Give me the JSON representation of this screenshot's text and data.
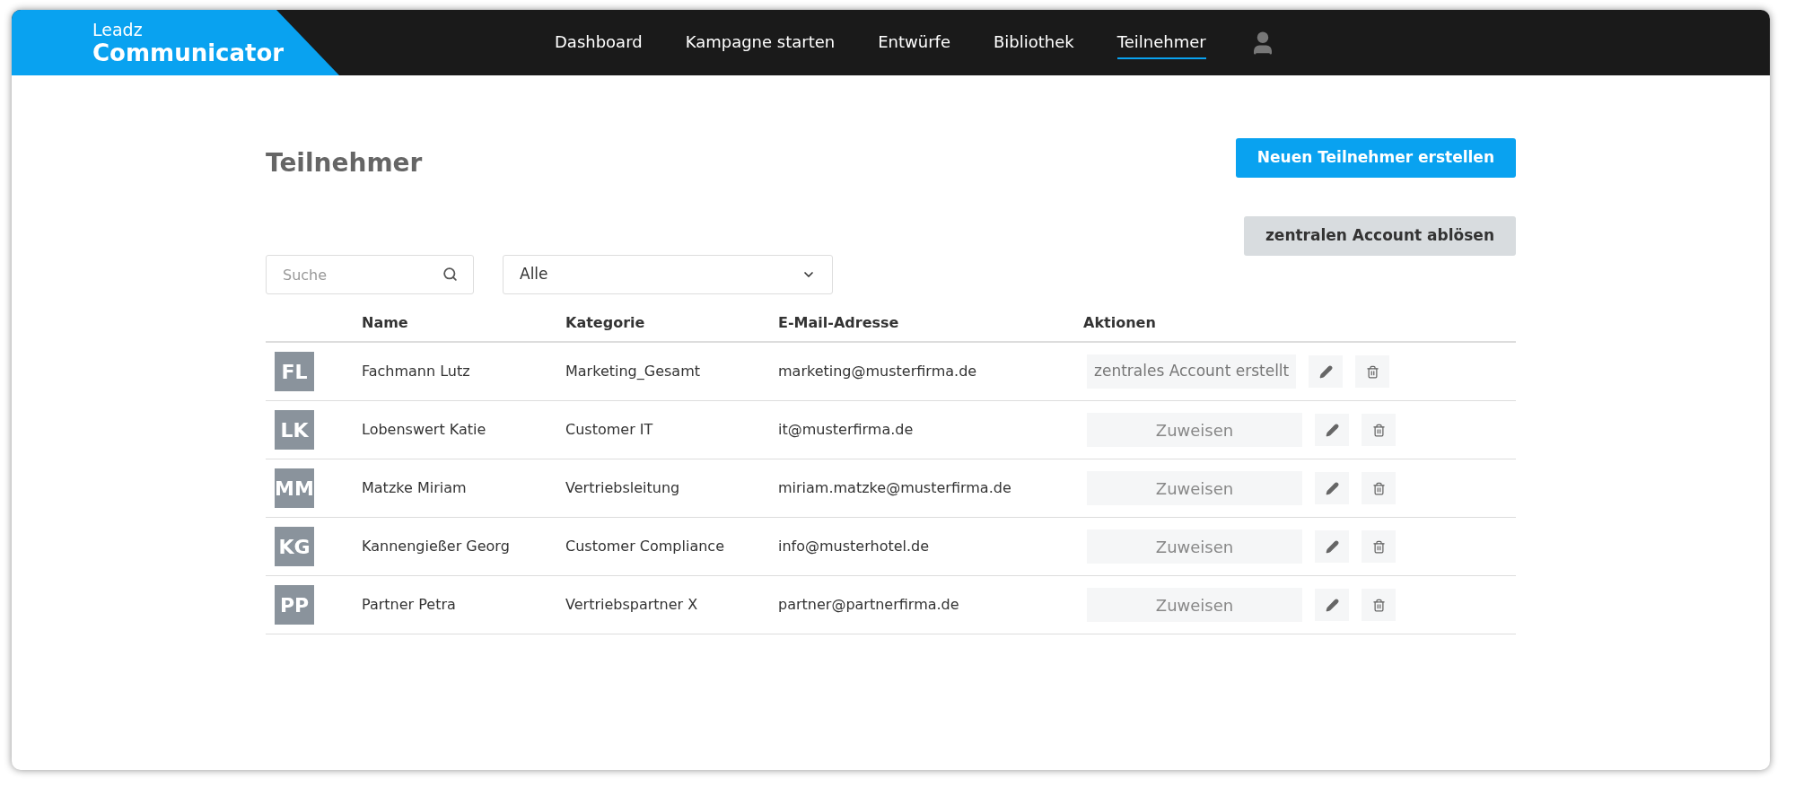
{
  "brand": {
    "top": "Leadz",
    "name": "Communicator"
  },
  "nav": [
    {
      "label": "Dashboard",
      "selected": false
    },
    {
      "label": "Kampagne starten",
      "selected": false
    },
    {
      "label": "Entwürfe",
      "selected": false
    },
    {
      "label": "Bibliothek",
      "selected": false
    },
    {
      "label": "Teilnehmer",
      "selected": true
    }
  ],
  "page_title": "Teilnehmer",
  "buttons": {
    "create": "Neuen Teilnehmer erstellen",
    "replace": "zentralen Account ablösen"
  },
  "search": {
    "placeholder": "Suche"
  },
  "filter": {
    "value": "Alle"
  },
  "table": {
    "columns": [
      "Name",
      "Kategorie",
      "E-Mail-Adresse",
      "Aktionen"
    ],
    "rows": [
      {
        "initials": "FL",
        "name": "Fachmann Lutz",
        "category": "Marketing_Gesamt",
        "email": "marketing@musterfirma.de",
        "action": {
          "kind": "status",
          "label": "zentrales Account erstellt"
        }
      },
      {
        "initials": "LK",
        "name": "Lobenswert Katie",
        "category": "Customer IT",
        "email": "it@musterfirma.de",
        "action": {
          "kind": "assign",
          "label": "Zuweisen"
        }
      },
      {
        "initials": "MM",
        "name": "Matzke Miriam",
        "category": "Vertriebsleitung",
        "email": "miriam.matzke@musterfirma.de",
        "action": {
          "kind": "assign",
          "label": "Zuweisen"
        }
      },
      {
        "initials": "KG",
        "name": "Kannengießer Georg",
        "category": "Customer Compliance",
        "email": "info@musterhotel.de",
        "action": {
          "kind": "assign",
          "label": "Zuweisen"
        }
      },
      {
        "initials": "PP",
        "name": "Partner Petra",
        "category": "Vertriebspartner X",
        "email": "partner@partnerfirma.de",
        "action": {
          "kind": "assign",
          "label": "Zuweisen"
        }
      }
    ]
  }
}
